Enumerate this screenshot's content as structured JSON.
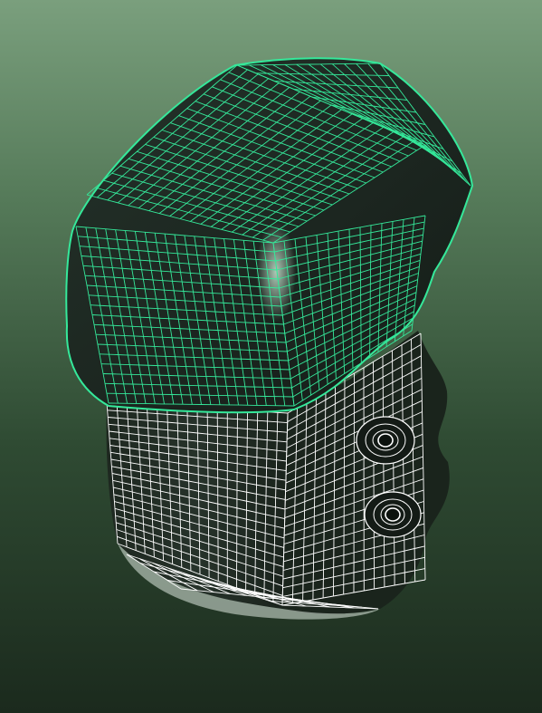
{
  "viewport": {
    "kind": "3d-wireframe-viewport",
    "background_top": "#7a9f7d",
    "background_bottom": "#1b2a1d"
  },
  "model": {
    "parts": [
      {
        "name": "cap",
        "wire_color": "#35e89a",
        "shade_color": "#1d2a21",
        "selected": true
      },
      {
        "name": "base",
        "wire_color": "#ffffff",
        "shade_color": "#1f2a21",
        "selected": false
      }
    ],
    "features": [
      "mounting-hole",
      "mounting-hole"
    ]
  }
}
